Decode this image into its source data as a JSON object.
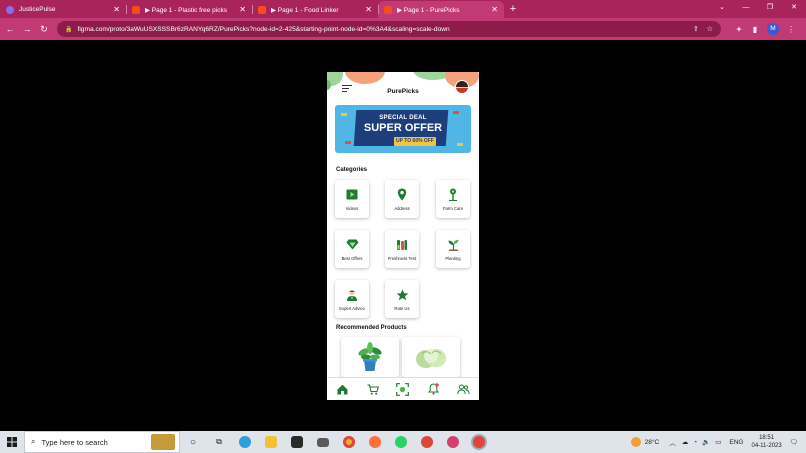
{
  "browser": {
    "tabs": [
      {
        "title": "JusticePulse",
        "favicon_color": "#8e6be8",
        "active": false
      },
      {
        "title": "▶ Page 1 - Plastic free picks",
        "favicon_color": "#f24e1e",
        "active": false
      },
      {
        "title": "▶ Page 1 - Food Linker",
        "favicon_color": "#f24e1e",
        "active": false
      },
      {
        "title": "▶ Page 1 - PurePicks",
        "favicon_color": "#f24e1e",
        "active": true
      }
    ],
    "new_tab": "+",
    "url": "figma.com/proto/3aWuUSXSSSBr6zRANYq6RZ/PurePicks?node-id=2-425&starting-point-node-id=0%3A4&scaling=scale-down",
    "profile_initial": "M",
    "accent": "#c23a74"
  },
  "app": {
    "title": "PurePicks",
    "banner": {
      "line1": "SPECIAL DEAL",
      "line2": "SUPER OFFER",
      "badge": "UP TO 60% OFF"
    },
    "categories_title": "Categories",
    "categories": [
      {
        "label": "Videos",
        "icon": "video-icon"
      },
      {
        "label": "Address",
        "icon": "location-pin-icon"
      },
      {
        "label": "Farm Care",
        "icon": "signpost-icon"
      },
      {
        "label": "Best Offers",
        "icon": "diamond-icon"
      },
      {
        "label": "Freshness Test",
        "icon": "test-tubes-icon"
      },
      {
        "label": "Planting",
        "icon": "sprout-icon"
      },
      {
        "label": "Expert Advice",
        "icon": "expert-icon"
      },
      {
        "label": "Rate Us",
        "icon": "star-icon"
      }
    ],
    "recommended_title": "Recommended Products",
    "products": [
      {
        "name": "potted-plant"
      },
      {
        "name": "cabbage"
      }
    ],
    "nav_icons": [
      "home-icon",
      "cart-icon",
      "scan-icon",
      "notification-icon",
      "community-icon"
    ],
    "brand_green": "#1e7a35"
  },
  "taskbar": {
    "search_placeholder": "Type here to search",
    "weather": "28°C",
    "language": "ENG",
    "time": "18:51",
    "date": "04-11-2023"
  }
}
